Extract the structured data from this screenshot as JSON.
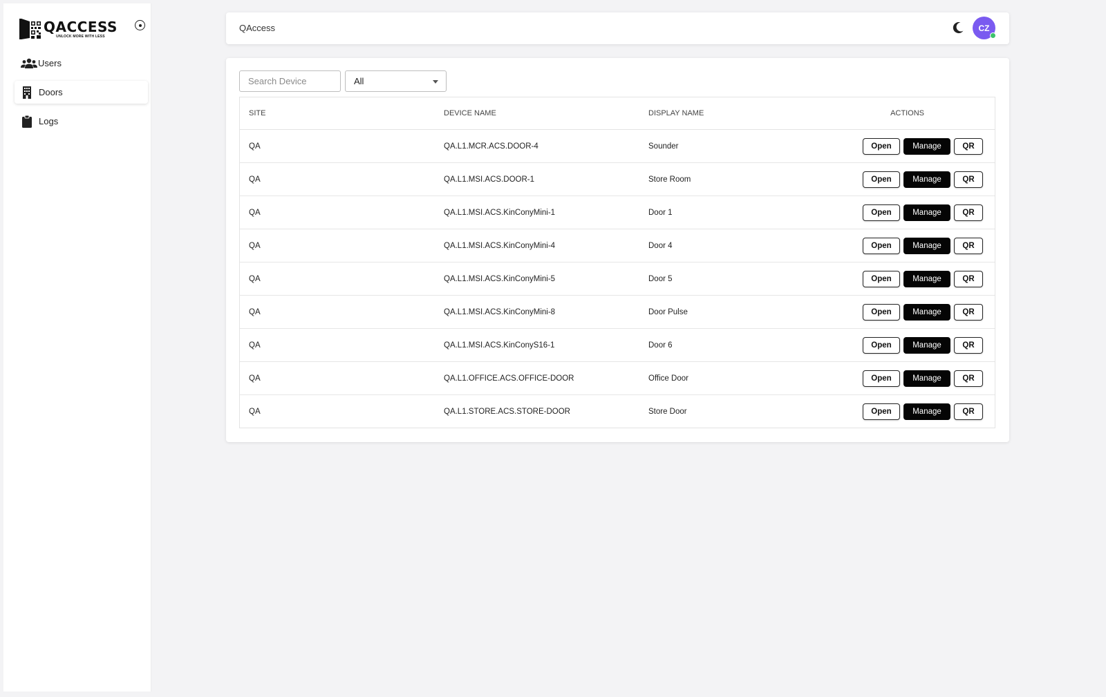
{
  "brand": {
    "name": "QACCESS",
    "tagline": "UNLOCK MORE WITH LESS"
  },
  "sidebar": {
    "items": [
      {
        "label": "Users",
        "icon": "users-icon",
        "active": false
      },
      {
        "label": "Doors",
        "icon": "building-icon",
        "active": true
      },
      {
        "label": "Logs",
        "icon": "clipboard-icon",
        "active": false
      }
    ]
  },
  "header": {
    "title": "QAccess",
    "avatar_initials": "CZ"
  },
  "filters": {
    "search_placeholder": "Search Device",
    "site_selected": "All"
  },
  "table": {
    "columns": {
      "site": "SITE",
      "device": "DEVICE NAME",
      "display": "DISPLAY NAME",
      "actions": "ACTIONS"
    },
    "action_labels": {
      "open": "Open",
      "manage": "Manage",
      "qr": "QR"
    },
    "rows": [
      {
        "site": "QA",
        "device": "QA.L1.MCR.ACS.DOOR-4",
        "display": "Sounder"
      },
      {
        "site": "QA",
        "device": "QA.L1.MSI.ACS.DOOR-1",
        "display": "Store Room"
      },
      {
        "site": "QA",
        "device": "QA.L1.MSI.ACS.KinConyMini-1",
        "display": "Door 1"
      },
      {
        "site": "QA",
        "device": "QA.L1.MSI.ACS.KinConyMini-4",
        "display": "Door 4"
      },
      {
        "site": "QA",
        "device": "QA.L1.MSI.ACS.KinConyMini-5",
        "display": "Door 5"
      },
      {
        "site": "QA",
        "device": "QA.L1.MSI.ACS.KinConyMini-8",
        "display": "Door Pulse"
      },
      {
        "site": "QA",
        "device": "QA.L1.MSI.ACS.KinConyS16-1",
        "display": "Door 6"
      },
      {
        "site": "QA",
        "device": "QA.L1.OFFICE.ACS.OFFICE-DOOR",
        "display": "Office Door"
      },
      {
        "site": "QA",
        "device": "QA.L1.STORE.ACS.STORE-DOOR",
        "display": "Store Door"
      }
    ]
  },
  "colors": {
    "avatar": "#7a5af0",
    "online": "#3cc26b",
    "primary_button": "#050505"
  }
}
